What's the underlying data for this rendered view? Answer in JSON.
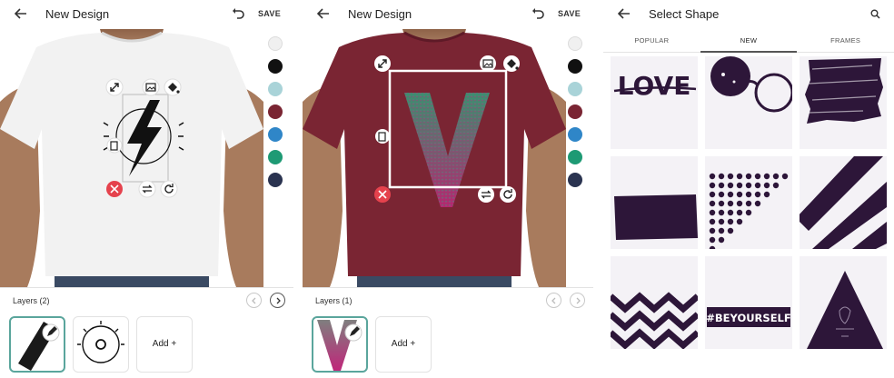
{
  "screens": {
    "editor_white": {
      "title": "New Design",
      "save_label": "SAVE",
      "layers_label": "Layers (2)",
      "add_label": "Add +",
      "shirt_color": "#f2f2f2"
    },
    "editor_maroon": {
      "title": "New Design",
      "save_label": "SAVE",
      "layers_label": "Layers (1)",
      "add_label": "Add +",
      "shirt_color": "#7a2533"
    },
    "select_shape": {
      "title": "Select Shape",
      "tabs": [
        {
          "label": "POPULAR"
        },
        {
          "label": "NEW"
        },
        {
          "label": "FRAMES"
        }
      ],
      "active_tab": "NEW",
      "shapes": [
        {
          "name": "love-text",
          "text": "LOVE"
        },
        {
          "name": "sunglasses"
        },
        {
          "name": "brush-scribble"
        },
        {
          "name": "brush-stroke"
        },
        {
          "name": "dot-triangle"
        },
        {
          "name": "diagonal-stripes"
        },
        {
          "name": "zigzag"
        },
        {
          "name": "beyourself-banner",
          "text": "#BEYOURSELF"
        },
        {
          "name": "triangle-art"
        }
      ]
    }
  },
  "palette": [
    "#f0f0f0",
    "#111111",
    "#a9d3d8",
    "#7a2533",
    "#2f86c8",
    "#1e9a74",
    "#2a3350"
  ],
  "colors": {
    "shape_ink": "#2d1639",
    "delete_red": "#e5424d",
    "selected_border": "#5aa59c"
  }
}
